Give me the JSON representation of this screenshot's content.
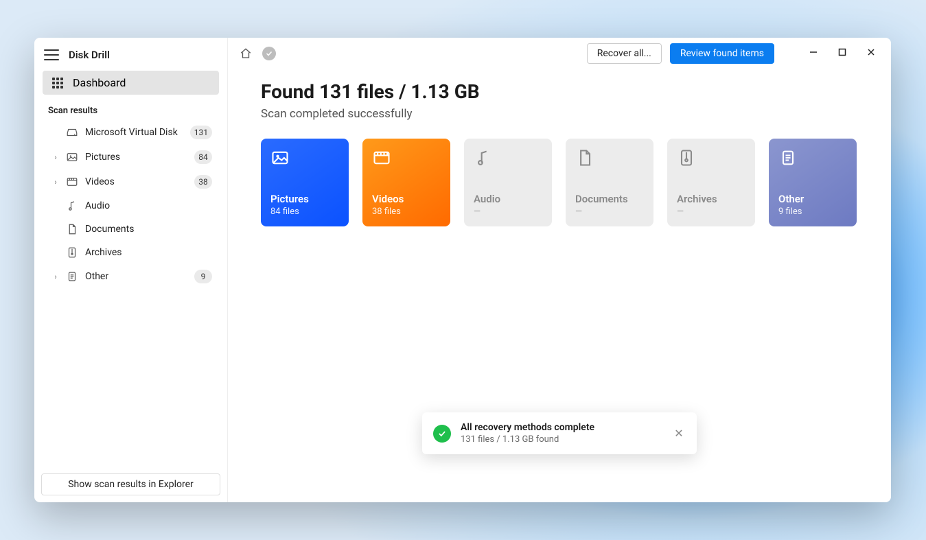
{
  "app_title": "Disk Drill",
  "sidebar": {
    "dashboard_label": "Dashboard",
    "section_label": "Scan results",
    "items": [
      {
        "label": "Microsoft Virtual Disk",
        "count": "131",
        "chevron": false,
        "icon": "disk"
      },
      {
        "label": "Pictures",
        "count": "84",
        "chevron": true,
        "icon": "image"
      },
      {
        "label": "Videos",
        "count": "38",
        "chevron": true,
        "icon": "video"
      },
      {
        "label": "Audio",
        "count": "",
        "chevron": false,
        "icon": "audio"
      },
      {
        "label": "Documents",
        "count": "",
        "chevron": false,
        "icon": "doc"
      },
      {
        "label": "Archives",
        "count": "",
        "chevron": false,
        "icon": "archive"
      },
      {
        "label": "Other",
        "count": "9",
        "chevron": true,
        "icon": "other"
      }
    ],
    "footer_label": "Show scan results in Explorer"
  },
  "topbar": {
    "recover_label": "Recover all...",
    "review_label": "Review found items"
  },
  "headline": "Found 131 files / 1.13 GB",
  "subhead": "Scan completed successfully",
  "cards": {
    "pictures": {
      "title": "Pictures",
      "sub": "84 files"
    },
    "videos": {
      "title": "Videos",
      "sub": "38 files"
    },
    "audio": {
      "title": "Audio",
      "sub": "—"
    },
    "documents": {
      "title": "Documents",
      "sub": "—"
    },
    "archives": {
      "title": "Archives",
      "sub": "—"
    },
    "other": {
      "title": "Other",
      "sub": "9 files"
    }
  },
  "toast": {
    "title": "All recovery methods complete",
    "sub": "131 files / 1.13 GB found"
  }
}
